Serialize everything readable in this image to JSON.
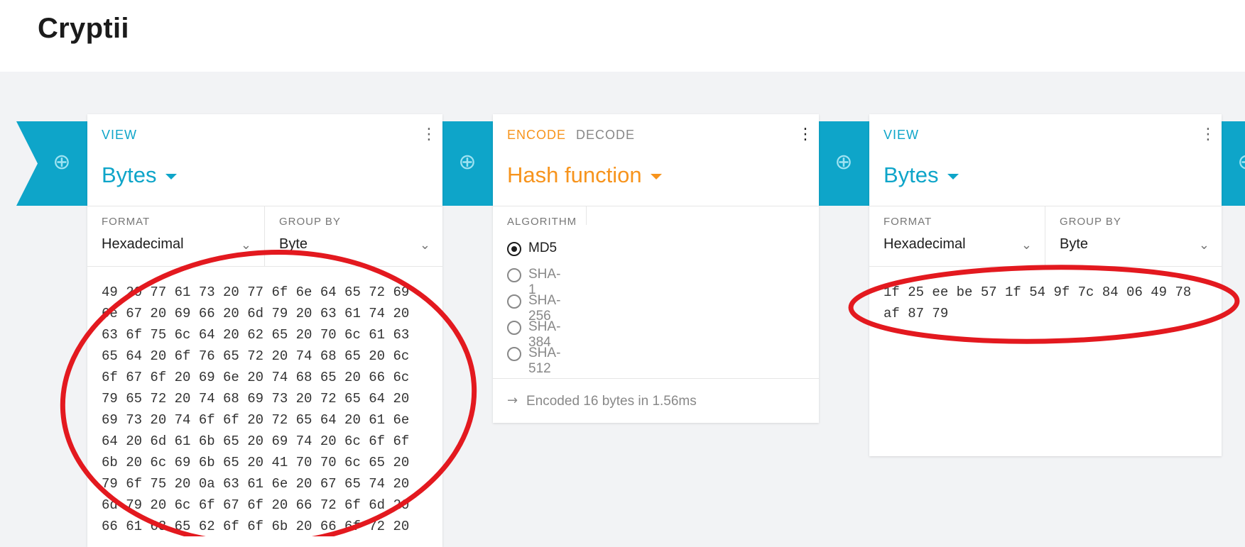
{
  "app": {
    "title": "Cryptii"
  },
  "bricks": [
    {
      "mode_label": "VIEW",
      "title": "Bytes",
      "settings": [
        {
          "label": "FORMAT",
          "value": "Hexadecimal"
        },
        {
          "label": "GROUP BY",
          "value": "Byte"
        }
      ],
      "content_lines": [
        "49 20 77 61 73 20 77 6f 6e 64 65 72 69",
        "6e 67 20 69 66 20 6d 79 20 63 61 74 20",
        "63 6f 75 6c 64 20 62 65 20 70 6c 61 63",
        "65 64 20 6f 76 65 72 20 74 68 65 20 6c",
        "6f 67 6f 20 69 6e 20 74 68 65 20 66 6c",
        "79 65 72 20 74 68 69 73 20 72 65 64 20",
        "69 73 20 74 6f 6f 20 72 65 64 20 61 6e",
        "64 20 6d 61 6b 65 20 69 74 20 6c 6f 6f",
        "6b 20 6c 69 6b 65 20 41 70 70 6c 65 20",
        "79 6f 75 20 0a 63 61 6e 20 67 65 74 20",
        "6d 79 20 6c 6f 67 6f 20 66 72 6f 6d 20",
        "66 61 63 65 62 6f 6f 6b 20 66 6f 72 20"
      ]
    },
    {
      "mode_active": "ENCODE",
      "mode_inactive": "DECODE",
      "title": "Hash function",
      "algorithm_label": "ALGORITHM",
      "algorithms": [
        "MD5",
        "SHA-1",
        "SHA-256",
        "SHA-384",
        "SHA-512"
      ],
      "selected_algorithm": "MD5",
      "status": "Encoded 16 bytes in 1.56ms"
    },
    {
      "mode_label": "VIEW",
      "title": "Bytes",
      "settings": [
        {
          "label": "FORMAT",
          "value": "Hexadecimal"
        },
        {
          "label": "GROUP BY",
          "value": "Byte"
        }
      ],
      "content_lines": [
        "1f 25 ee be 57 1f 54 9f 7c 84 06 49 78",
        "af 87 79"
      ]
    }
  ],
  "icons": {
    "add": "plus-circle-icon",
    "menu": "vertical-dots-icon",
    "dropdown": "caret-down-icon",
    "select": "chevron-down-icon",
    "status": "arrow-right-icon"
  },
  "colors": {
    "accent_blue": "#0ea5c9",
    "accent_orange": "#f7941d",
    "annotation_red": "#e3191f",
    "background": "#f2f3f5"
  }
}
